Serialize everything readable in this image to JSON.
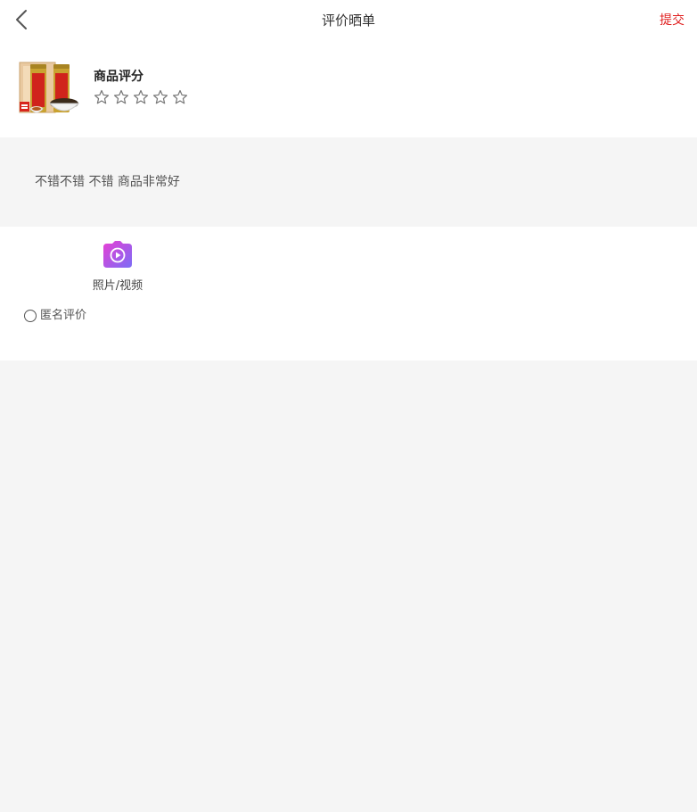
{
  "header": {
    "title": "评价晒单",
    "submit_label": "提交"
  },
  "product": {
    "thumbnail_icon": "product-thumbnail-tea-gift-box",
    "rating_label": "商品评分",
    "stars_total": 5,
    "stars_selected": 0
  },
  "review": {
    "text": "不错不错 不错 商品非常好"
  },
  "media": {
    "upload_label": "照片/视频",
    "upload_icon": "camera-video-icon"
  },
  "anonymous": {
    "label": "匿名评价",
    "checked": false
  },
  "colors": {
    "accent": "#e02020",
    "background": "#f5f5f5",
    "panel": "#ffffff",
    "camera_gradient_start": "#e83fd4",
    "camera_gradient_end": "#7b6cf6"
  }
}
